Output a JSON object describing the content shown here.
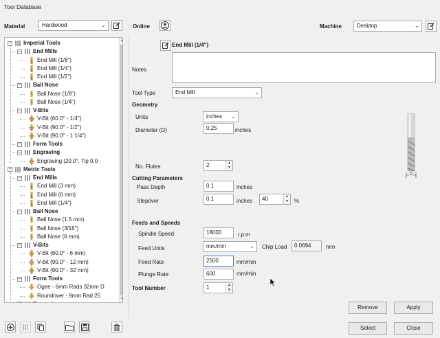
{
  "window": {
    "title": "Tool Database"
  },
  "header": {
    "material_label": "Material",
    "material_value": "Hardwood",
    "online_label": "Online",
    "machine_label": "Machine",
    "machine_value": "Desktop"
  },
  "tree": {
    "nodes": [
      {
        "label": "Imperial Tools",
        "level": 0,
        "bold": true,
        "type": "group"
      },
      {
        "label": "End Mills",
        "level": 1,
        "bold": true,
        "type": "group"
      },
      {
        "label": "End Mill (1/8\")",
        "level": 2,
        "bold": false,
        "type": "endmill"
      },
      {
        "label": "End Mill (1/4\")",
        "level": 2,
        "bold": false,
        "type": "endmill"
      },
      {
        "label": "End Mill (1/2\")",
        "level": 2,
        "bold": false,
        "type": "endmill"
      },
      {
        "label": "Ball Nose",
        "level": 1,
        "bold": true,
        "type": "group"
      },
      {
        "label": "Ball Nose (1/8\")",
        "level": 2,
        "bold": false,
        "type": "ballnose"
      },
      {
        "label": "Ball Nose (1/4\")",
        "level": 2,
        "bold": false,
        "type": "ballnose"
      },
      {
        "label": "V-Bits",
        "level": 1,
        "bold": true,
        "type": "group"
      },
      {
        "label": "V-Bit (60.0° - 1/4\")",
        "level": 2,
        "bold": false,
        "type": "vbit"
      },
      {
        "label": "V-Bit (90.0° - 1/2\")",
        "level": 2,
        "bold": false,
        "type": "vbit"
      },
      {
        "label": "V-Bit (90.0° - 1 1/4\")",
        "level": 2,
        "bold": false,
        "type": "vbit"
      },
      {
        "label": "Form Tools",
        "level": 1,
        "bold": true,
        "type": "group"
      },
      {
        "label": "Engraving",
        "level": 1,
        "bold": true,
        "type": "group"
      },
      {
        "label": "Engraving (20.0°, Tip 0.0",
        "level": 2,
        "bold": false,
        "type": "vbit"
      },
      {
        "label": "Metric Tools",
        "level": 0,
        "bold": true,
        "type": "group"
      },
      {
        "label": "End Mills",
        "level": 1,
        "bold": true,
        "type": "group"
      },
      {
        "label": "End Mill (3 mm)",
        "level": 2,
        "bold": false,
        "type": "endmill"
      },
      {
        "label": "End Mill (6 mm)",
        "level": 2,
        "bold": false,
        "type": "endmill"
      },
      {
        "label": "End Mill (1/4\")",
        "level": 2,
        "bold": false,
        "type": "endmill"
      },
      {
        "label": "Ball Nose",
        "level": 1,
        "bold": true,
        "type": "group"
      },
      {
        "label": "Ball Nose (1.5 mm)",
        "level": 2,
        "bold": false,
        "type": "ballnose"
      },
      {
        "label": "Ball Nose (3/16\")",
        "level": 2,
        "bold": false,
        "type": "ballnose"
      },
      {
        "label": "Ball Nose (6 mm)",
        "level": 2,
        "bold": false,
        "type": "ballnose"
      },
      {
        "label": "V-Bits",
        "level": 1,
        "bold": true,
        "type": "group"
      },
      {
        "label": "V-Bit (60.0° - 6 mm)",
        "level": 2,
        "bold": false,
        "type": "vbit"
      },
      {
        "label": "V-Bit (90.0° - 12 mm)",
        "level": 2,
        "bold": false,
        "type": "vbit"
      },
      {
        "label": "V-Bit (90.0° - 32 mm)",
        "level": 2,
        "bold": false,
        "type": "vbit"
      },
      {
        "label": "Form Tools",
        "level": 1,
        "bold": true,
        "type": "group"
      },
      {
        "label": "Ogee - 6mm Rads 32mm D",
        "level": 2,
        "bold": false,
        "type": "form"
      },
      {
        "label": "Roundover - 9mm Rad 25",
        "level": 2,
        "bold": false,
        "type": "form"
      },
      {
        "label": "Engraving",
        "level": 1,
        "bold": true,
        "type": "group"
      }
    ]
  },
  "tool": {
    "name": "End Mill (1/4\")",
    "notes_label": "Notes",
    "notes_value": "",
    "tool_type_label": "Tool Type",
    "tool_type_value": "End Mill"
  },
  "geometry": {
    "heading": "Geometry",
    "units_label": "Units",
    "units_value": "inches",
    "diameter_label": "Diameter (D)",
    "diameter_value": "0.25",
    "diameter_unit": "inches",
    "flutes_label": "No. Flutes",
    "flutes_value": "2",
    "dim_label": "D"
  },
  "cutting": {
    "heading": "Cutting Parameters",
    "pass_depth_label": "Pass Depth",
    "pass_depth_value": "0.1",
    "pass_depth_unit": "inches",
    "stepover_label": "Stepover",
    "stepover_value": "0.1",
    "stepover_unit": "inches",
    "stepover_pct_value": "40",
    "stepover_pct_unit": "%"
  },
  "feeds": {
    "heading": "Feeds and Speeds",
    "spindle_label": "Spindle Speed",
    "spindle_value": "18000",
    "spindle_unit": "r.p.m",
    "feed_units_label": "Feed Units",
    "feed_units_value": "mm/min",
    "chip_load_label": "Chip Load",
    "chip_load_value": "0.0694",
    "chip_load_unit": "mm",
    "feed_rate_label": "Feed Rate",
    "feed_rate_value": "2500",
    "feed_rate_unit": "mm/min",
    "plunge_label": "Plunge Rate",
    "plunge_value": "600",
    "plunge_unit": "mm/min"
  },
  "tool_number": {
    "label": "Tool Number",
    "value": "1"
  },
  "buttons": {
    "remove": "Remove",
    "apply": "Apply",
    "select": "Select",
    "close": "Close"
  }
}
